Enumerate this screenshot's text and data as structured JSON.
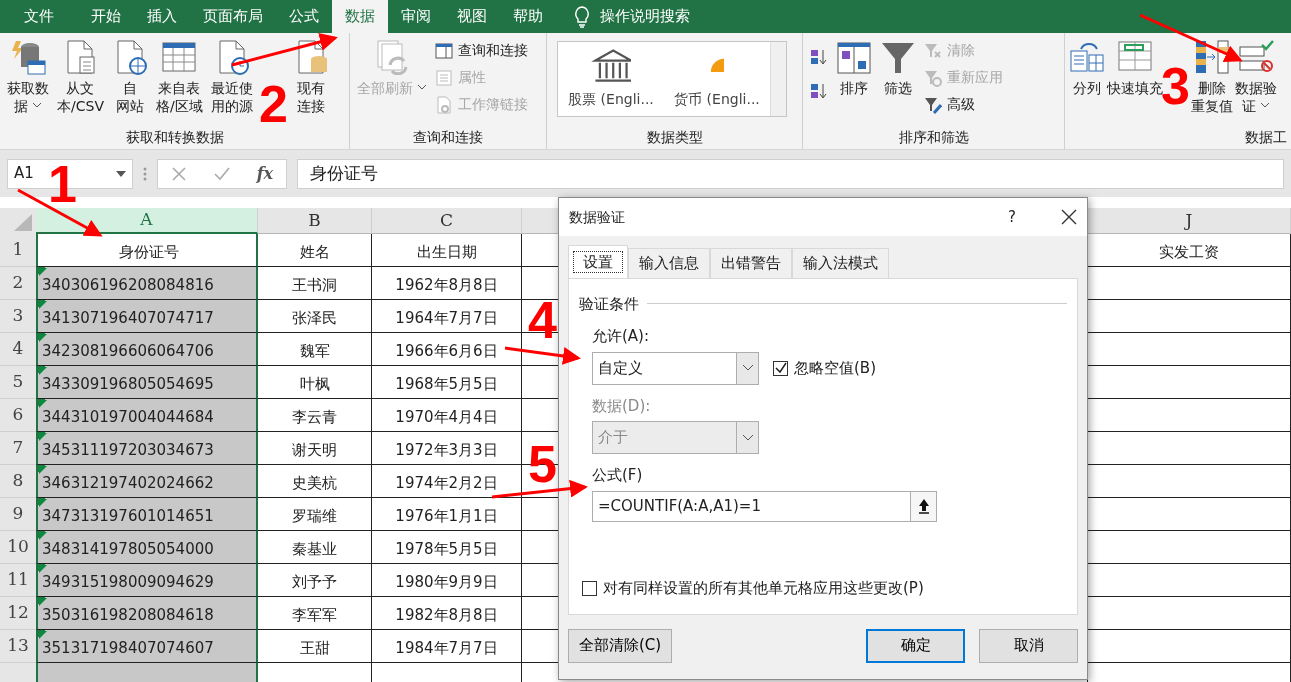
{
  "ribbon_tabs": [
    {
      "label": "文件",
      "selected": false
    },
    {
      "label": "开始",
      "selected": false
    },
    {
      "label": "插入",
      "selected": false
    },
    {
      "label": "页面布局",
      "selected": false
    },
    {
      "label": "公式",
      "selected": false
    },
    {
      "label": "数据",
      "selected": true
    },
    {
      "label": "审阅",
      "selected": false
    },
    {
      "label": "视图",
      "selected": false
    },
    {
      "label": "帮助",
      "selected": false
    }
  ],
  "tell_me": "操作说明搜索",
  "ribbon_groups": [
    {
      "title": "获取和转换数据",
      "items": [
        {
          "kind": "large",
          "lines": [
            "获取数",
            "据"
          ],
          "dropdown": true,
          "disabled": false
        },
        {
          "kind": "large",
          "lines": [
            "从文",
            "本/CSV"
          ],
          "dropdown": false,
          "disabled": false
        },
        {
          "kind": "large",
          "lines": [
            "自",
            "网站"
          ],
          "dropdown": false,
          "disabled": false
        },
        {
          "kind": "large",
          "lines": [
            "来自表",
            "格/区域"
          ],
          "dropdown": false,
          "disabled": false
        },
        {
          "kind": "large",
          "lines": [
            "最近使",
            "用的源"
          ],
          "dropdown": false,
          "disabled": false
        },
        {
          "kind": "large",
          "lines": [
            "现有",
            "连接"
          ],
          "dropdown": false,
          "disabled": false
        }
      ]
    },
    {
      "title": "查询和连接",
      "items": [
        {
          "kind": "large",
          "lines": [
            "全部刷新"
          ],
          "dropdown": true,
          "disabled": true
        },
        {
          "kind": "stack",
          "buttons": [
            {
              "label": "查询和连接",
              "disabled": false
            },
            {
              "label": "属性",
              "disabled": true
            },
            {
              "label": "工作簿链接",
              "disabled": true
            }
          ]
        }
      ]
    },
    {
      "title": "数据类型",
      "items": [
        {
          "kind": "gallery",
          "entries": [
            "股票 (Engli...",
            "货币 (Engli..."
          ]
        }
      ]
    },
    {
      "title": "排序和筛选",
      "items": [
        {
          "kind": "icons"
        },
        {
          "kind": "large",
          "lines": [
            "排序"
          ],
          "dropdown": false,
          "disabled": false
        },
        {
          "kind": "large",
          "lines": [
            "筛选"
          ],
          "dropdown": false,
          "disabled": false
        },
        {
          "kind": "stack",
          "buttons": [
            {
              "label": "清除",
              "disabled": true
            },
            {
              "label": "重新应用",
              "disabled": true
            },
            {
              "label": "高级",
              "disabled": false
            }
          ]
        }
      ]
    },
    {
      "title": "数据工",
      "items": [
        {
          "kind": "large",
          "lines": [
            "分列"
          ],
          "dropdown": false,
          "disabled": false
        },
        {
          "kind": "large",
          "lines": [
            "快速填充"
          ],
          "dropdown": false,
          "disabled": false
        },
        {
          "kind": "large",
          "lines": [
            "删除",
            "重复值"
          ],
          "dropdown": false,
          "disabled": false
        },
        {
          "kind": "large",
          "lines": [
            "数据验",
            "证"
          ],
          "dropdown": true,
          "disabled": false
        }
      ]
    }
  ],
  "formula_bar": {
    "name_box": "A1",
    "function_label": "fx",
    "content": "身份证号"
  },
  "sheet": {
    "columns": [
      {
        "label": "A",
        "selected": true
      },
      {
        "label": "B",
        "selected": false
      },
      {
        "label": "C",
        "selected": false
      },
      {
        "label": "J",
        "selected": false
      }
    ],
    "rows": [
      {
        "number": "1",
        "cells": [
          "身份证号",
          "姓名",
          "出生日期",
          "实发工资"
        ],
        "error_flag": false
      },
      {
        "number": "2",
        "cells": [
          "340306196208084816",
          "王书洞",
          "1962年8月8日",
          ""
        ],
        "error_flag": true
      },
      {
        "number": "3",
        "cells": [
          "341307196407074717",
          "张泽民",
          "1964年7月7日",
          ""
        ],
        "error_flag": true
      },
      {
        "number": "4",
        "cells": [
          "342308196606064706",
          "魏军",
          "1966年6月6日",
          ""
        ],
        "error_flag": true
      },
      {
        "number": "5",
        "cells": [
          "343309196805054695",
          "叶枫",
          "1968年5月5日",
          ""
        ],
        "error_flag": true
      },
      {
        "number": "6",
        "cells": [
          "344310197004044684",
          "李云青",
          "1970年4月4日",
          ""
        ],
        "error_flag": true
      },
      {
        "number": "7",
        "cells": [
          "345311197203034673",
          "谢天明",
          "1972年3月3日",
          ""
        ],
        "error_flag": true
      },
      {
        "number": "8",
        "cells": [
          "346312197402024662",
          "史美杭",
          "1974年2月2日",
          ""
        ],
        "error_flag": true
      },
      {
        "number": "9",
        "cells": [
          "347313197601014651",
          "罗瑞维",
          "1976年1月1日",
          ""
        ],
        "error_flag": true
      },
      {
        "number": "10",
        "cells": [
          "348314197805054000",
          "秦基业",
          "1978年5月5日",
          ""
        ],
        "error_flag": true
      },
      {
        "number": "11",
        "cells": [
          "349315198009094629",
          "刘予予",
          "1980年9月9日",
          ""
        ],
        "error_flag": true
      },
      {
        "number": "12",
        "cells": [
          "350316198208084618",
          "李军军",
          "1982年8月8日",
          ""
        ],
        "error_flag": true
      },
      {
        "number": "13",
        "cells": [
          "351317198407074607",
          "王甜",
          "1984年7月7日",
          ""
        ],
        "error_flag": true
      }
    ]
  },
  "dialog": {
    "title": "数据验证",
    "help": "?",
    "tabs": [
      {
        "label": "设置",
        "selected": true
      },
      {
        "label": "输入信息",
        "selected": false
      },
      {
        "label": "出错警告",
        "selected": false
      },
      {
        "label": "输入法模式",
        "selected": false
      }
    ],
    "section": "验证条件",
    "allow_label": "允许(A):",
    "allow_value": "自定义",
    "ignore_blank": {
      "label": "忽略空值(B)",
      "checked": true
    },
    "data_label": "数据(D):",
    "data_value": "介于",
    "data_disabled": true,
    "formula_label": "公式(F)",
    "formula_value": "=COUNTIF(A:A,A1)=1",
    "apply_all": {
      "label": "对有同样设置的所有其他单元格应用这些更改(P)",
      "checked": false
    },
    "buttons": [
      {
        "label": "全部清除(C)",
        "kind": "left"
      },
      {
        "label": "确定",
        "kind": "default"
      },
      {
        "label": "取消",
        "kind": "normal"
      }
    ]
  },
  "annotations": [
    {
      "label": "1"
    },
    {
      "label": "2"
    },
    {
      "label": "3"
    },
    {
      "label": "4"
    },
    {
      "label": "5"
    }
  ]
}
